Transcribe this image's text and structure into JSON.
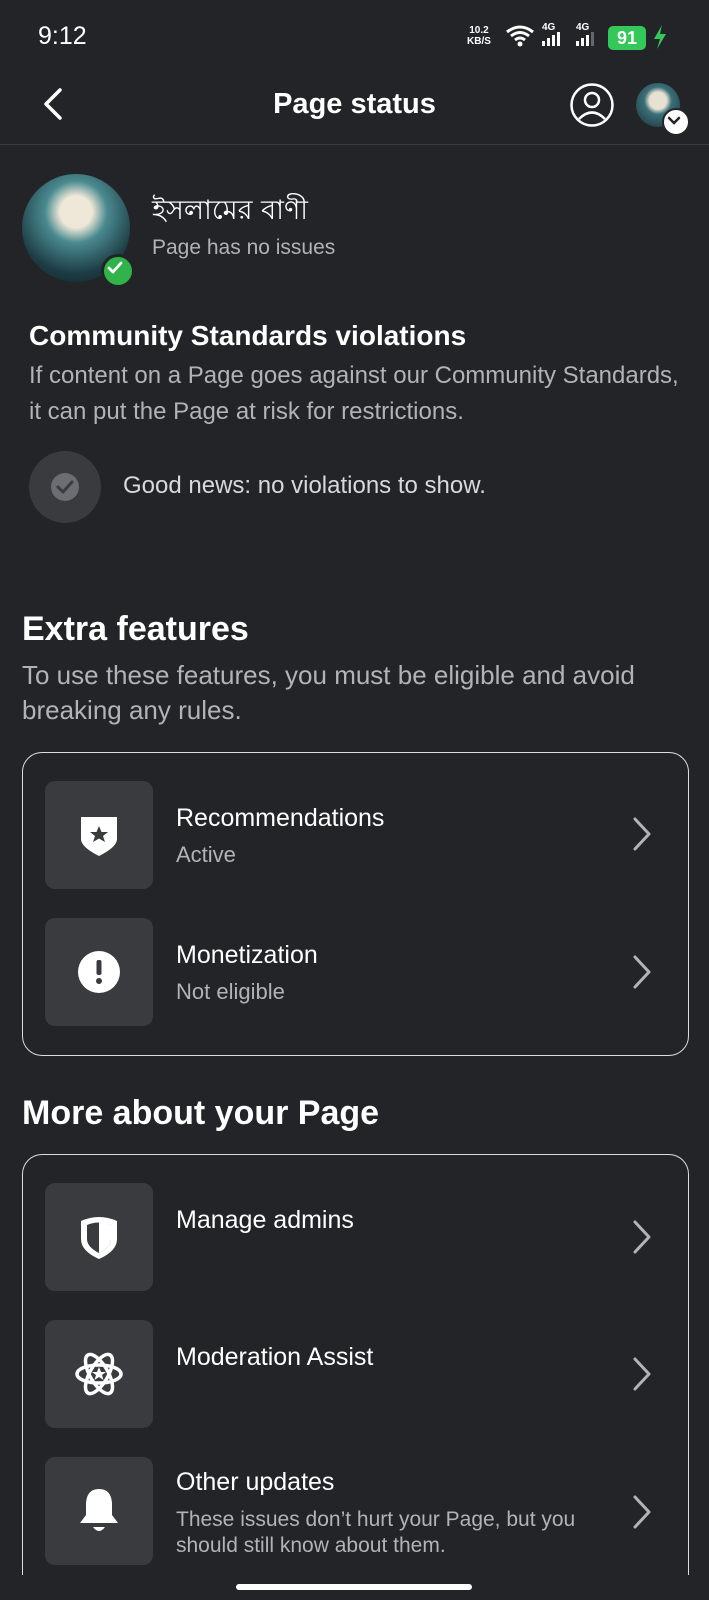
{
  "status_bar": {
    "time": "9:12",
    "net_speed_value": "10.2",
    "net_speed_unit": "KB/S",
    "signal1_label": "4G",
    "signal2_label": "4G",
    "battery": "91"
  },
  "header": {
    "title": "Page status",
    "icons": [
      "back-arrow-icon",
      "profile-icon",
      "avatar-switcher"
    ]
  },
  "page": {
    "name": "ইসলামের বাণী",
    "status": "Page has no issues"
  },
  "community": {
    "title": "Community Standards violations",
    "description": "If content on a Page goes against our Community Standards, it can put the Page at risk for restrictions.",
    "good_news": "Good news: no violations to show."
  },
  "extra_features": {
    "title": "Extra features",
    "description": "To use these features, you must be eligible and avoid breaking any rules.",
    "items": [
      {
        "title": "Recommendations",
        "subtitle": "Active",
        "icon": "star-shield-icon"
      },
      {
        "title": "Monetization",
        "subtitle": "Not eligible",
        "icon": "exclamation-icon"
      }
    ]
  },
  "more_about": {
    "title": "More about your Page",
    "items": [
      {
        "title": "Manage admins",
        "subtitle": "",
        "icon": "shield-icon"
      },
      {
        "title": "Moderation Assist",
        "subtitle": "",
        "icon": "atom-star-icon"
      },
      {
        "title": "Other updates",
        "subtitle": "These issues don’t hurt your Page, but you should still know about them.",
        "icon": "bell-icon"
      }
    ]
  },
  "colors": {
    "background": "#232427",
    "secondary_text": "#b0b3b8",
    "verified_green": "#30b34a",
    "battery_green": "#34c759",
    "icon_tile": "#3a3b3f"
  }
}
